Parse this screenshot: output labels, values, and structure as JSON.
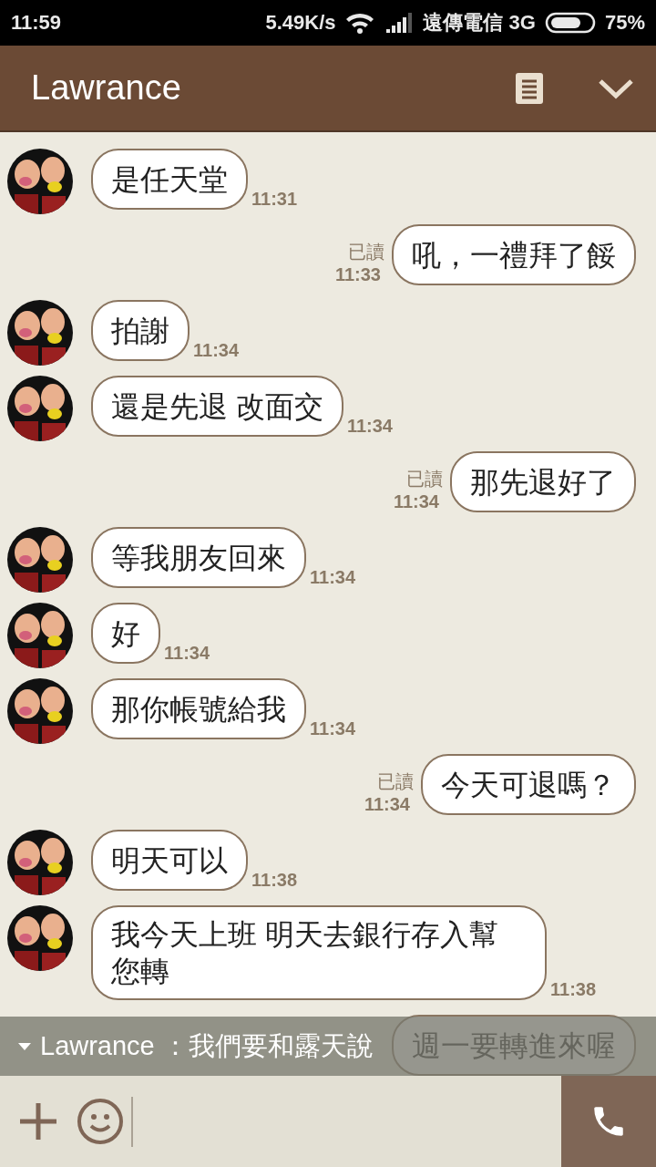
{
  "status_bar": {
    "time": "11:59",
    "speed": "5.49K/s",
    "carrier": "遠傳電信 3G",
    "battery": "75%"
  },
  "header": {
    "title": "Lawrance"
  },
  "messages": [
    {
      "kind": "incoming",
      "text": "是任天堂",
      "time": "11:31"
    },
    {
      "kind": "outgoing",
      "text": "吼，一禮拜了餒",
      "time": "11:33",
      "read": "已讀"
    },
    {
      "kind": "incoming",
      "text": "拍謝",
      "time": "11:34"
    },
    {
      "kind": "incoming",
      "text": "還是先退 改面交",
      "time": "11:34"
    },
    {
      "kind": "outgoing",
      "text": "那先退好了",
      "time": "11:34",
      "read": "已讀"
    },
    {
      "kind": "incoming",
      "text": "等我朋友回來",
      "time": "11:34"
    },
    {
      "kind": "incoming",
      "text": "好",
      "time": "11:34"
    },
    {
      "kind": "incoming",
      "text": "那你帳號給我",
      "time": "11:34"
    },
    {
      "kind": "outgoing",
      "text": "今天可退嗎？",
      "time": "11:34",
      "read": "已讀"
    },
    {
      "kind": "incoming",
      "text": "明天可以",
      "time": "11:38"
    },
    {
      "kind": "incoming",
      "text": "我今天上班 明天去銀行存入幫您轉",
      "time": "11:38"
    },
    {
      "kind": "outgoing",
      "text": "週一要轉進來喔"
    }
  ],
  "notification": {
    "text": "Lawrance ：我們要和露天說"
  }
}
